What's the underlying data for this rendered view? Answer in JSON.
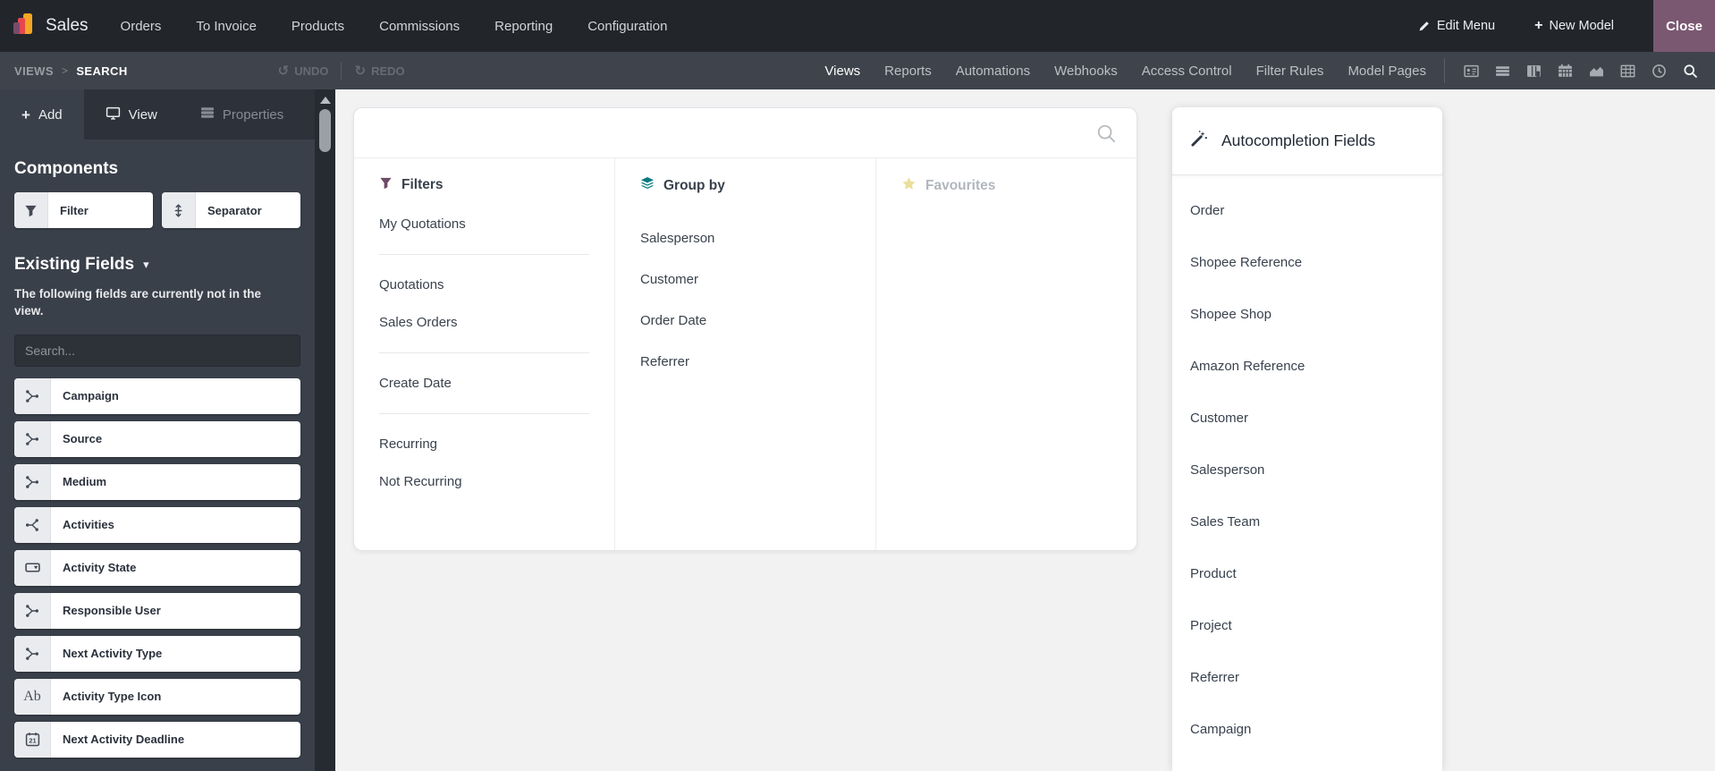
{
  "colors": {
    "topbar_bg": "#22262b",
    "toolbar_bg": "#3f444c",
    "sidebar_bg": "#3a404a",
    "close_button_bg": "#7b5871",
    "canvas_bg": "#f2f2f3",
    "filters_icon": "#6d4a66",
    "group_by_icon": "#0b7b80",
    "favourites_icon": "#eadf9c",
    "logo_purple": "#7a4a6d",
    "logo_red": "#e5484f",
    "logo_yellow": "#f5a623"
  },
  "topbar": {
    "app_name": "Sales",
    "menus": [
      "Orders",
      "To Invoice",
      "Products",
      "Commissions",
      "Reporting",
      "Configuration"
    ],
    "edit_menu_label": "Edit Menu",
    "new_model_label": "New Model",
    "close_label": "Close"
  },
  "toolbar": {
    "breadcrumb": {
      "parent": "VIEWS",
      "separator": ">",
      "current": "SEARCH"
    },
    "undo_label": "UNDO",
    "redo_label": "REDO",
    "undo_icon": "↺",
    "redo_icon": "↻",
    "tabs": [
      "Views",
      "Reports",
      "Automations",
      "Webhooks",
      "Access Control",
      "Filter Rules",
      "Model Pages"
    ],
    "active_tab": "Views",
    "view_type_icons": [
      "form-view-icon",
      "list-view-icon",
      "kanban-view-icon",
      "calendar-view-icon",
      "graph-view-icon",
      "pivot-view-icon",
      "activity-view-icon",
      "search-view-icon"
    ],
    "active_view_icon": "search-view-icon"
  },
  "sidebar": {
    "tabs": [
      {
        "label": "Add",
        "active": true
      },
      {
        "label": "View",
        "active": false
      },
      {
        "label": "Properties",
        "active": false,
        "disabled": true
      }
    ],
    "components_title": "Components",
    "components": [
      {
        "label": "Filter",
        "icon": "filter-icon"
      },
      {
        "label": "Separator",
        "icon": "separator-icon"
      }
    ],
    "existing_fields_title": "Existing Fields",
    "existing_fields_caret": "▾",
    "existing_fields_note": "The following fields are currently not in the view.",
    "search_placeholder": "Search...",
    "fields": [
      {
        "label": "Campaign",
        "type": "many2one"
      },
      {
        "label": "Source",
        "type": "many2one"
      },
      {
        "label": "Medium",
        "type": "many2one"
      },
      {
        "label": "Activities",
        "type": "one2many"
      },
      {
        "label": "Activity State",
        "type": "selection"
      },
      {
        "label": "Responsible User",
        "type": "many2one"
      },
      {
        "label": "Next Activity Type",
        "type": "many2one"
      },
      {
        "label": "Activity Type Icon",
        "type": "char",
        "icon_text": "Ab"
      },
      {
        "label": "Next Activity Deadline",
        "type": "date",
        "icon_text": "21"
      }
    ]
  },
  "preview": {
    "filters": {
      "title": "Filters",
      "groups": [
        [
          "My Quotations"
        ],
        [
          "Quotations",
          "Sales Orders"
        ],
        [
          "Create Date"
        ],
        [
          "Recurring",
          "Not Recurring"
        ]
      ]
    },
    "group_by": {
      "title": "Group by",
      "items": [
        "Salesperson",
        "Customer",
        "Order Date",
        "Referrer"
      ]
    },
    "favourites": {
      "title": "Favourites",
      "items": []
    }
  },
  "autocompletion": {
    "title": "Autocompletion Fields",
    "items": [
      "Order",
      "Shopee Reference",
      "Shopee Shop",
      "Amazon Reference",
      "Customer",
      "Salesperson",
      "Sales Team",
      "Product",
      "Project",
      "Referrer",
      "Campaign"
    ]
  }
}
